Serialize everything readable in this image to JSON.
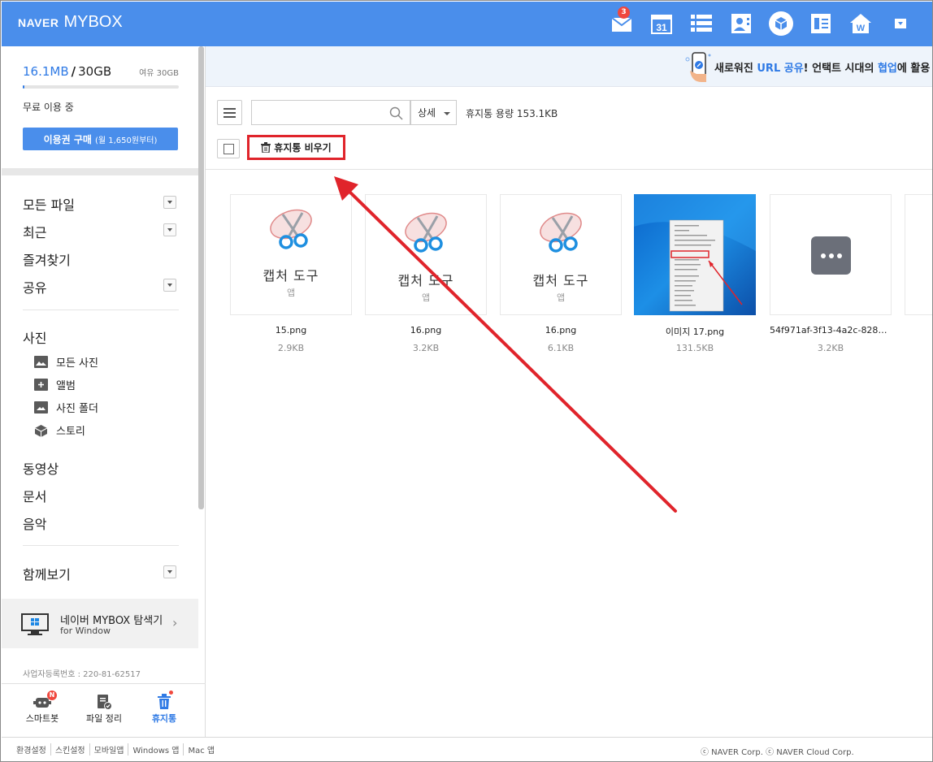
{
  "header": {
    "brand": "NAVER",
    "product": "MYBOX",
    "mail_badge": "3",
    "calendar_day": "31"
  },
  "sidebar": {
    "used": "16.1MB",
    "separator": "/",
    "total": "30GB",
    "free": "여유 30GB",
    "usage_fraction": 0.0005,
    "plan": "무료 이용 중",
    "buy_label": "이용권 구매",
    "buy_sub": "(월 1,650원부터)",
    "nav": [
      "모든 파일",
      "최근",
      "즐겨찾기",
      "공유"
    ],
    "photos_title": "사진",
    "photos": [
      "모든 사진",
      "앨범",
      "사진 폴더",
      "스토리"
    ],
    "media": [
      "동영상",
      "문서",
      "음악"
    ],
    "together": "함께보기",
    "explorer_title": "네이버 MYBOX 탐색기",
    "explorer_sub": "for Window",
    "biz": "사업자등록번호 : 220-81-62517",
    "bottom": [
      {
        "label": "스마트봇",
        "badge": "N"
      },
      {
        "label": "파일 정리"
      },
      {
        "label": "휴지통"
      }
    ]
  },
  "banner": {
    "pre": "새로워진 ",
    "hl1": "URL 공유",
    "mid": "! 언택트 시대의 ",
    "hl2": "협업",
    "post": "에 활용"
  },
  "toolbar": {
    "search_placeholder": "",
    "detail": "상세",
    "capacity": "휴지통 용량 153.1KB",
    "empty_button": "휴지통 비우기"
  },
  "files": [
    {
      "name": "15.png",
      "size": "2.9KB",
      "app": "캡처 도구",
      "kind": "앱"
    },
    {
      "name": "16.png",
      "size": "3.2KB",
      "app": "캡처 도구",
      "kind": "앱"
    },
    {
      "name": "16.png",
      "size": "6.1KB",
      "app": "캡처 도구",
      "kind": "앱"
    },
    {
      "name": "이미지 17.png",
      "size": "131.5KB"
    },
    {
      "name": "54f971af-3f13-4a2c-828e…",
      "size": "3.2KB"
    }
  ],
  "footer": {
    "links": [
      "환경설정",
      "스킨설정",
      "모바일앱",
      "Windows 앱",
      "Mac 앱"
    ],
    "copyright": "ⓒ NAVER Corp. ⓒ NAVER Cloud Corp."
  },
  "colors": {
    "brand": "#4a8eeb",
    "accent": "#2f7ae5",
    "annotation": "#e0242b"
  }
}
